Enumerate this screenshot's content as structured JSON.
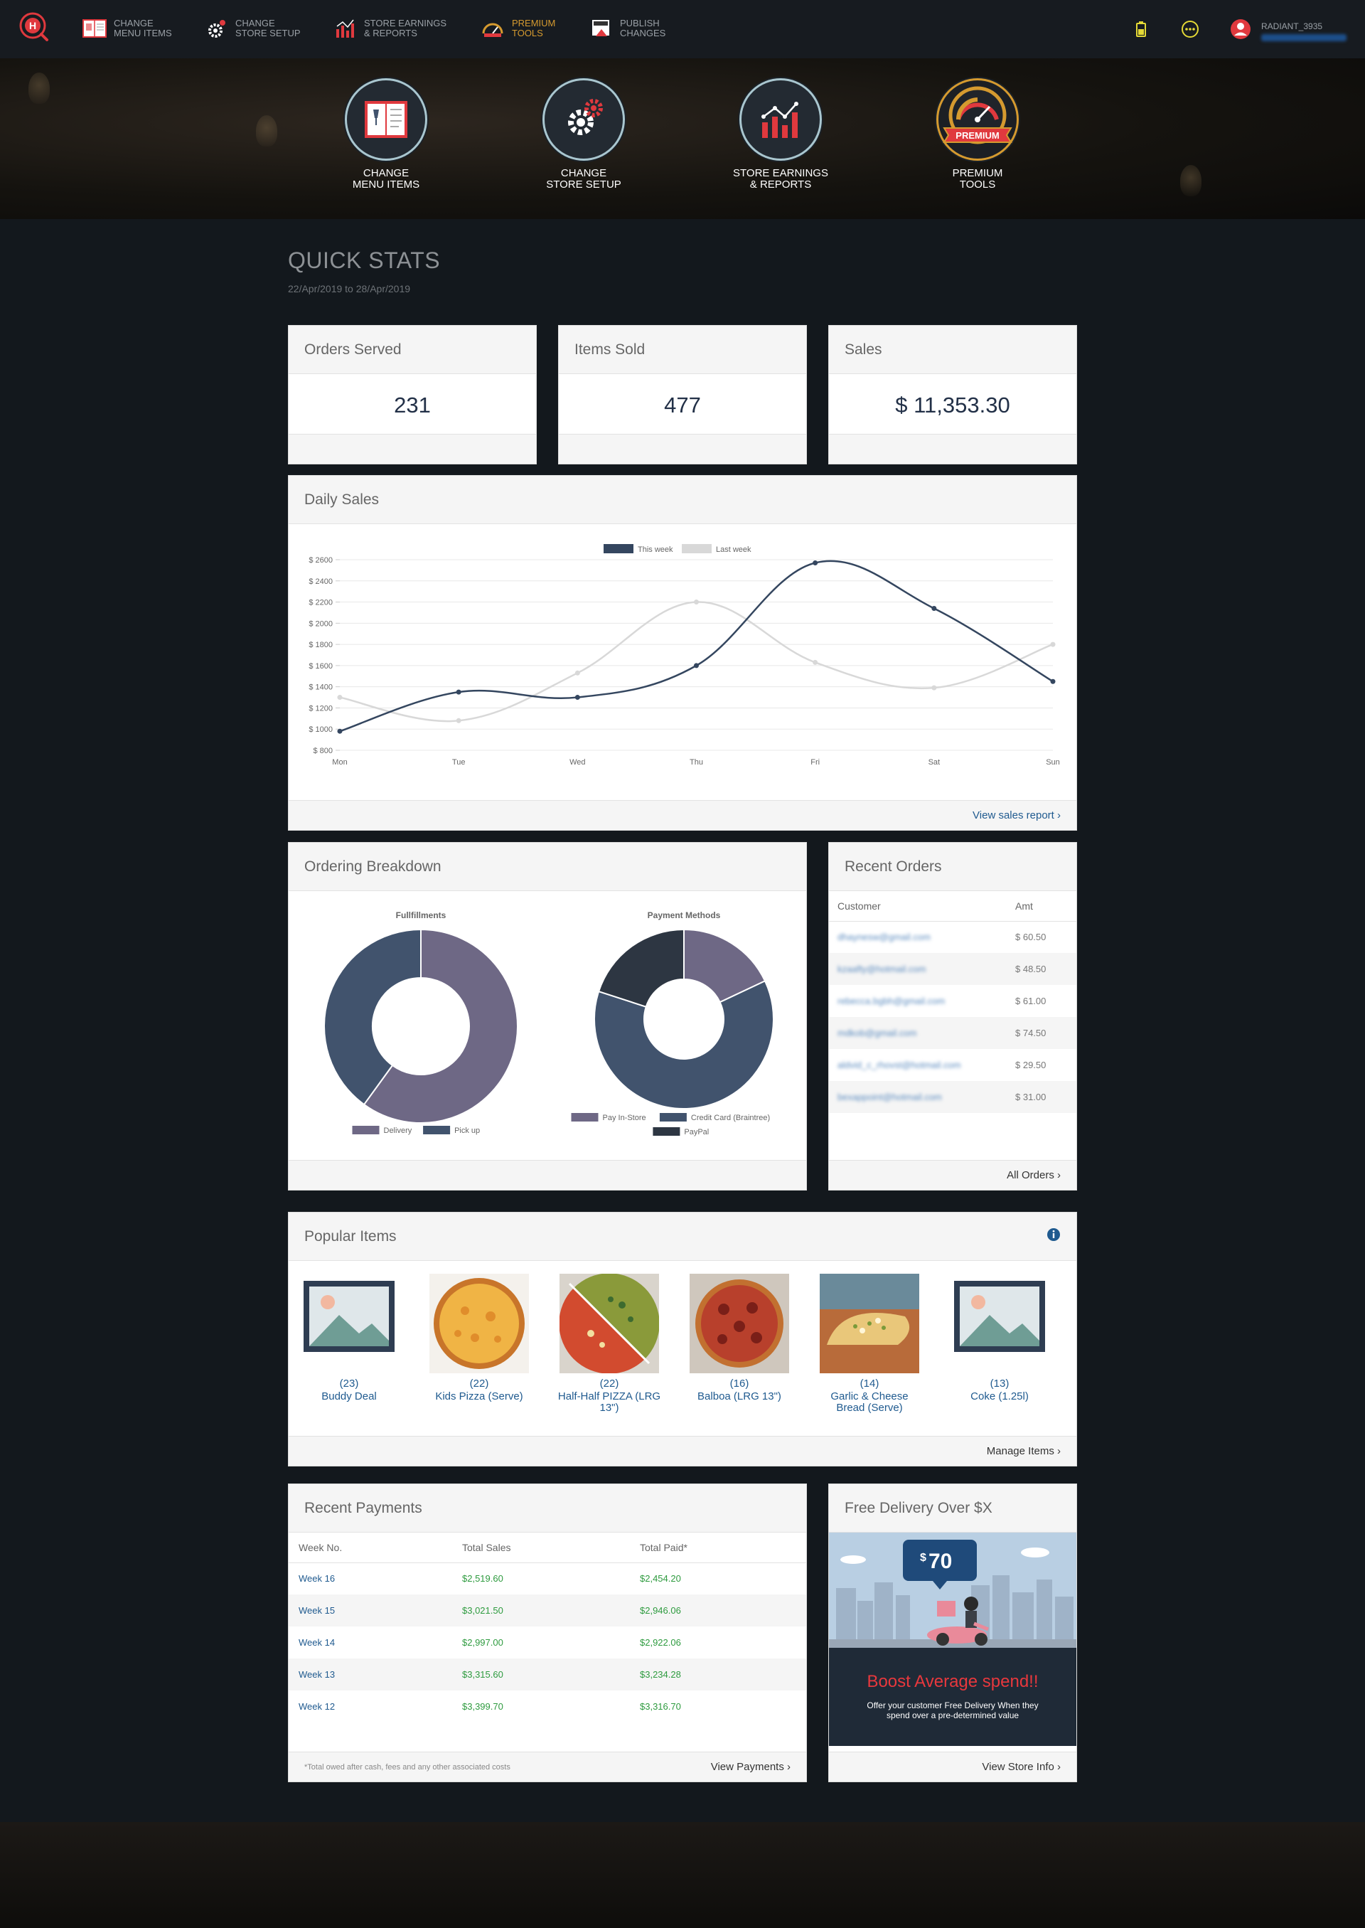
{
  "nav": {
    "items": [
      {
        "label": "CHANGE\nMENU ITEMS",
        "icon": "menu-book-icon"
      },
      {
        "label": "CHANGE\nSTORE SETUP",
        "icon": "gear-icon"
      },
      {
        "label": "STORE EARNINGS\n& REPORTS",
        "icon": "bar-chart-icon"
      },
      {
        "label": "PREMIUM\nTOOLS",
        "icon": "speedometer-icon"
      },
      {
        "label": "PUBLISH\nCHANGES",
        "icon": "publish-icon"
      }
    ],
    "user_name": "RADIANT_3935"
  },
  "hero": {
    "tiles": [
      {
        "label": "CHANGE\nMENU ITEMS"
      },
      {
        "label": "CHANGE\nSTORE SETUP"
      },
      {
        "label": "STORE EARNINGS\n& REPORTS"
      },
      {
        "label": "PREMIUM\nTOOLS",
        "badge": "PREMIUM"
      }
    ]
  },
  "quick_stats": {
    "title": "QUICK STATS",
    "range": "22/Apr/2019 to 28/Apr/2019",
    "cards": [
      {
        "title": "Orders Served",
        "value": "231"
      },
      {
        "title": "Items Sold",
        "value": "477"
      },
      {
        "title": "Sales",
        "value": "$ 11,353.30"
      }
    ]
  },
  "daily_sales": {
    "title": "Daily Sales",
    "footer_link": "View sales report ›"
  },
  "chart_data": [
    {
      "type": "line",
      "x": [
        "Mon",
        "Tue",
        "Wed",
        "Thu",
        "Fri",
        "Sat",
        "Sun"
      ],
      "series": [
        {
          "name": "This week",
          "values": [
            980,
            1350,
            1300,
            1600,
            2570,
            2140,
            1450
          ],
          "color": "#34465f"
        },
        {
          "name": "Last week",
          "values": [
            1300,
            1080,
            1530,
            2200,
            1630,
            1390,
            1800
          ],
          "color": "#d8d8d8"
        }
      ],
      "ylim": [
        800,
        2600
      ],
      "yticks": [
        "$ 800",
        "$ 1000",
        "$ 1200",
        "$ 1400",
        "$ 1600",
        "$ 1800",
        "$ 2000",
        "$ 2200",
        "$ 2400",
        "$ 2600"
      ],
      "legend": "top-center",
      "grid": true
    },
    {
      "type": "pie",
      "title": "Fullfillments",
      "labels": [
        "Delivery",
        "Pick up"
      ],
      "values": [
        60,
        40
      ],
      "colors": [
        "#6e6885",
        "#41536d"
      ],
      "legend": "bottom"
    },
    {
      "type": "pie",
      "title": "Payment Methods",
      "labels": [
        "Pay In-Store",
        "Credit Card (Braintree)",
        "PayPal"
      ],
      "values": [
        18,
        62,
        20
      ],
      "colors": [
        "#6e6885",
        "#41536d",
        "#2d3642"
      ],
      "legend": "bottom"
    }
  ],
  "ordering_breakdown": {
    "title": "Ordering Breakdown"
  },
  "recent_orders": {
    "title": "Recent Orders",
    "columns": [
      "Customer",
      "Amt"
    ],
    "rows": [
      {
        "customer": "dhaynesw@gmail.com",
        "amt": "$ 60.50"
      },
      {
        "customer": "kzaafty@hotmail.com",
        "amt": "$ 48.50"
      },
      {
        "customer": "rebecca.bgbh@gmail.com",
        "amt": "$ 61.00"
      },
      {
        "customer": "mdkob@gmail.com",
        "amt": "$ 74.50"
      },
      {
        "customer": "aldvid_c_rhovst@hotmail.com",
        "amt": "$ 29.50"
      },
      {
        "customer": "bexappoint@hotmail.com",
        "amt": "$ 31.00"
      }
    ],
    "footer_link": "All Orders ›"
  },
  "popular_items": {
    "title": "Popular Items",
    "items": [
      {
        "count": "(23)",
        "name": "Buddy Deal",
        "image": "placeholder"
      },
      {
        "count": "(22)",
        "name": "Kids Pizza (Serve)",
        "image": "pizza-cheese"
      },
      {
        "count": "(22)",
        "name": "Half-Half PIZZA (LRG 13\")",
        "image": "pizza-half"
      },
      {
        "count": "(16)",
        "name": "Balboa (LRG 13\")",
        "image": "pizza-meat"
      },
      {
        "count": "(14)",
        "name": "Garlic & Cheese Bread (Serve)",
        "image": "garlic-bread"
      },
      {
        "count": "(13)",
        "name": "Coke (1.25l)",
        "image": "placeholder"
      }
    ],
    "footer_link": "Manage Items ›"
  },
  "recent_payments": {
    "title": "Recent Payments",
    "columns": [
      "Week No.",
      "Total Sales",
      "Total Paid*"
    ],
    "rows": [
      {
        "week": "Week 16",
        "sales": "$2,519.60",
        "paid": "$2,454.20"
      },
      {
        "week": "Week 15",
        "sales": "$3,021.50",
        "paid": "$2,946.06"
      },
      {
        "week": "Week 14",
        "sales": "$2,997.00",
        "paid": "$2,922.06"
      },
      {
        "week": "Week 13",
        "sales": "$3,315.60",
        "paid": "$3,234.28"
      },
      {
        "week": "Week 12",
        "sales": "$3,399.70",
        "paid": "$3,316.70"
      }
    ],
    "footnote": "*Total owed after cash, fees and any other associated costs",
    "footer_link": "View Payments ›"
  },
  "free_delivery": {
    "title": "Free Delivery Over $X",
    "price_symbol": "$",
    "price": "70",
    "headline": "Boost Average spend!!",
    "body": "Offer your customer Free Delivery When they spend over a pre-determined value",
    "footer_link": "View Store Info ›"
  },
  "colors": {
    "accent": "#1f5a8f",
    "money": "#2e9b3f",
    "chart_this_week": "#34465f",
    "chart_last_week": "#d8d8d8",
    "promo_red": "#e8383d"
  }
}
